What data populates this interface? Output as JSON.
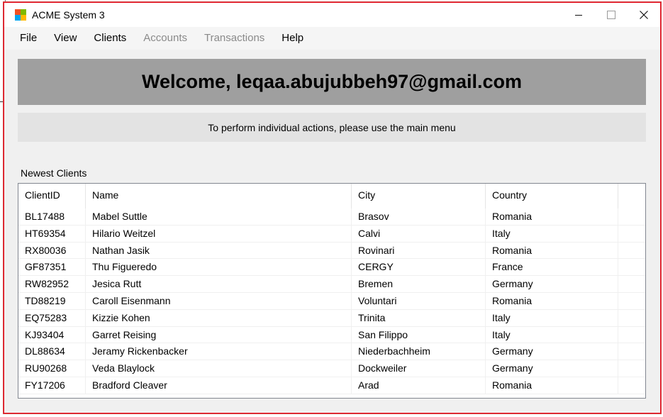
{
  "window": {
    "title": "ACME System 3"
  },
  "menu": [
    {
      "label": "File",
      "enabled": true
    },
    {
      "label": "View",
      "enabled": true
    },
    {
      "label": "Clients",
      "enabled": true
    },
    {
      "label": "Accounts",
      "enabled": false
    },
    {
      "label": "Transactions",
      "enabled": false
    },
    {
      "label": "Help",
      "enabled": true
    }
  ],
  "welcome": {
    "text": "Welcome, leqaa.abujubbeh97@gmail.com"
  },
  "info": {
    "text": "To perform individual actions, please use the main menu"
  },
  "clients_section": {
    "label": "Newest Clients",
    "columns": [
      "ClientID",
      "Name",
      "City",
      "Country"
    ],
    "rows": [
      [
        "BL17488",
        "Mabel Suttle",
        "Brasov",
        "Romania"
      ],
      [
        "HT69354",
        "Hilario Weitzel",
        "Calvi",
        "Italy"
      ],
      [
        "RX80036",
        "Nathan Jasik",
        "Rovinari",
        "Romania"
      ],
      [
        "GF87351",
        "Thu Figueredo",
        "CERGY",
        "France"
      ],
      [
        "RW82952",
        "Jesica Rutt",
        "Bremen",
        "Germany"
      ],
      [
        "TD88219",
        "Caroll Eisenmann",
        "Voluntari",
        "Romania"
      ],
      [
        "EQ75283",
        "Kizzie Kohen",
        "Trinita",
        "Italy"
      ],
      [
        "KJ93404",
        "Garret Reising",
        "San Filippo",
        "Italy"
      ],
      [
        "DL88634",
        "Jeramy Rickenbacker",
        "Niederbachheim",
        "Germany"
      ],
      [
        "RU90268",
        "Veda Blaylock",
        "Dockweiler",
        "Germany"
      ],
      [
        "FY17206",
        "Bradford Cleaver",
        "Arad",
        "Romania"
      ]
    ]
  },
  "colors": {
    "welcome_bg": "#9f9f9f",
    "info_bg": "#e3e3e3",
    "window_border": "#e81123",
    "disabled_menu": "#8a8a8a"
  }
}
